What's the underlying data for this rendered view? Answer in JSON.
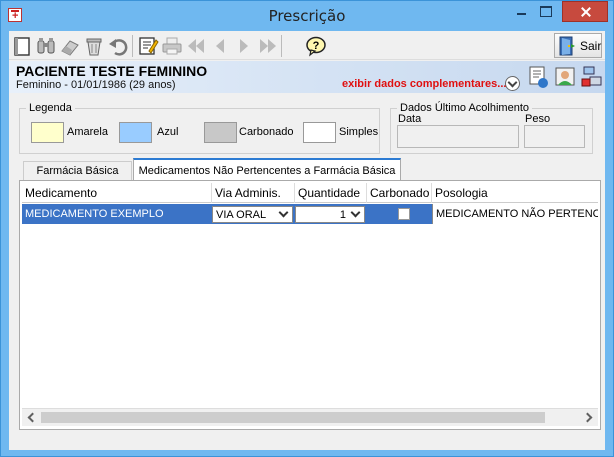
{
  "window": {
    "title": "Prescrição"
  },
  "toolbar": {
    "icons": [
      "new-icon",
      "binoculars-icon",
      "eraser-icon",
      "trash-icon",
      "undo-icon",
      "edit-icon",
      "printer-icon",
      "first-icon",
      "prev-icon",
      "next-icon",
      "last-icon",
      "help-icon"
    ],
    "sair_label": "Sair"
  },
  "patient": {
    "name": "PACIENTE TESTE FEMININO",
    "details": "Feminino - 01/01/1986 (29 anos)",
    "complement_link": "exibir dados complementares..."
  },
  "legenda": {
    "title": "Legenda",
    "items": [
      {
        "label": "Amarela",
        "color": "#ffffcc"
      },
      {
        "label": "Azul",
        "color": "#99ccff"
      },
      {
        "label": "Carbonado",
        "color": "#c8c8c8"
      },
      {
        "label": "Simples",
        "color": "#ffffff"
      }
    ]
  },
  "acolhimento": {
    "title": "Dados Último Acolhimento",
    "data_label": "Data",
    "data_value": "",
    "peso_label": "Peso",
    "peso_value": ""
  },
  "tabs": [
    {
      "label": "Farmácia Básica",
      "active": false
    },
    {
      "label": "Medicamentos Não Pertencentes a Farmácia Básica",
      "active": true
    }
  ],
  "grid": {
    "columns": [
      "Medicamento",
      "Via Adminis.",
      "Quantidade",
      "Carbonado",
      "Posologia"
    ],
    "rows": [
      {
        "medicamento": "MEDICAMENTO EXEMPLO",
        "via": "VIA ORAL",
        "quantidade": "1",
        "carbonado": false,
        "posologia": "MEDICAMENTO NÃO PERTENCENTE"
      }
    ]
  },
  "colors": {
    "titlebar": "#6fb8f0",
    "selection": "#3b73c6",
    "link": "#e01010",
    "close": "#c74a3e"
  }
}
